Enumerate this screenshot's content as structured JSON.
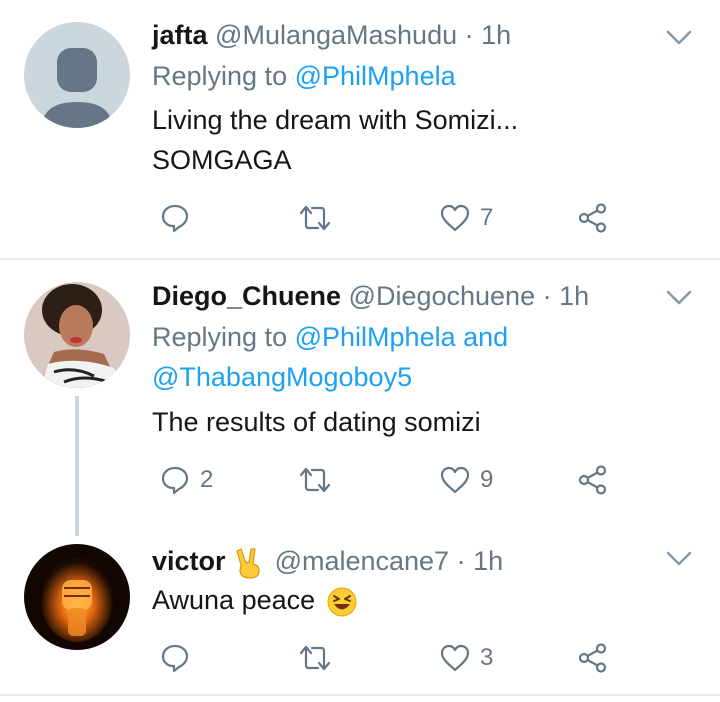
{
  "tweets": [
    {
      "name": "jafta",
      "handle": "@MulangaMashudu",
      "separator": "·",
      "time": "1h",
      "replying_prefix": "Replying to",
      "replying_to": "@PhilMphela",
      "replying_to_line2": "",
      "text_lines": [
        "Living the dream with Somizi...",
        "SOMGAGA"
      ],
      "reply_count": "",
      "retweet_count": "",
      "like_count": "7"
    },
    {
      "name": "Diego_Chuene",
      "handle": "@Diegochuene",
      "separator": "·",
      "time": "1h",
      "replying_prefix": "Replying to",
      "replying_to": "@PhilMphela and",
      "replying_to_line2": "@ThabangMogoboy5",
      "text_lines": [
        "The results of dating somizi"
      ],
      "reply_count": "2",
      "retweet_count": "",
      "like_count": "9"
    },
    {
      "name": "victor",
      "name_emoji": "victory-hand-emoji",
      "handle": "@malencane7",
      "separator": "·",
      "time": "1h",
      "text_lines": [
        "Awuna peace"
      ],
      "text_emoji": "laughing-face-emoji",
      "reply_count": "",
      "retweet_count": "",
      "like_count": "3"
    }
  ],
  "colors": {
    "text": "#14171a",
    "secondary": "#657786",
    "link": "#1da1f2",
    "divider": "#e6ecf0",
    "thread_line": "#ccd6dd"
  },
  "icons": [
    "reply-icon",
    "retweet-icon",
    "like-icon",
    "share-icon",
    "chevron-down-icon"
  ]
}
